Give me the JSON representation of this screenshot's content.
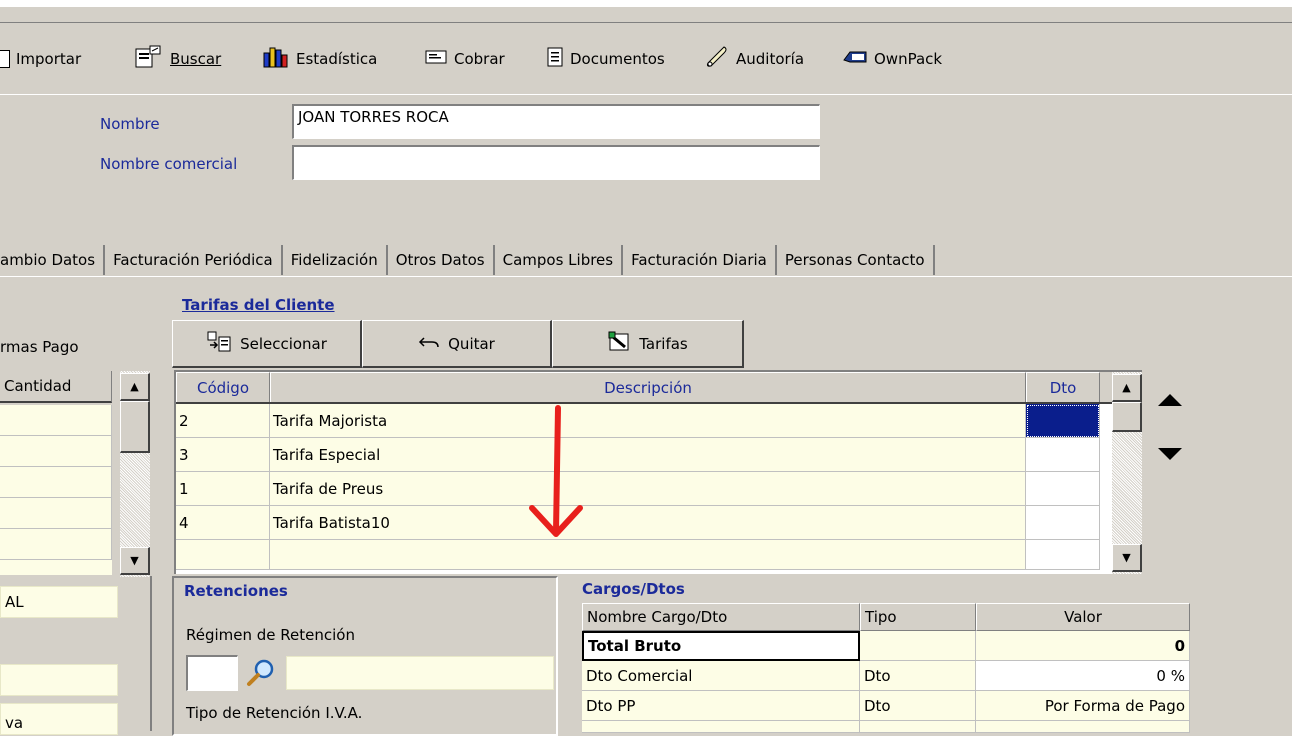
{
  "toolbar": {
    "importar": "Importar",
    "buscar": "Buscar",
    "estadistica": "Estadística",
    "cobrar": "Cobrar",
    "documentos": "Documentos",
    "auditoria": "Auditoría",
    "ownpack": "OwnPack"
  },
  "form": {
    "nombre_label": "Nombre",
    "nombre_value": "JOAN TORRES ROCA",
    "comercial_label": "Nombre comercial",
    "comercial_value": ""
  },
  "tabs": [
    {
      "label": "ambio Datos"
    },
    {
      "label": "Facturación Periódica"
    },
    {
      "label": "Fidelización"
    },
    {
      "label": "Otros Datos"
    },
    {
      "label": "Campos Libres"
    },
    {
      "label": "Facturación Diaria"
    },
    {
      "label": "Personas Contacto"
    }
  ],
  "left_panel": {
    "title": "rmas Pago",
    "column": "Cantidad",
    "field1": "AL",
    "field2": "",
    "field3": "va"
  },
  "tarifas": {
    "title": "Tarifas del Cliente",
    "buttons": {
      "seleccionar": "Seleccionar",
      "quitar": "Quitar",
      "tarifas": "Tarifas"
    },
    "columns": {
      "codigo": "Código",
      "descripcion": "Descripción",
      "dto": "Dto"
    },
    "rows": [
      {
        "codigo": "2",
        "descripcion": "Tarifa Majorista",
        "dto": ""
      },
      {
        "codigo": "3",
        "descripcion": "Tarifa Especial",
        "dto": ""
      },
      {
        "codigo": "1",
        "descripcion": "Tarifa de Preus",
        "dto": ""
      },
      {
        "codigo": "4",
        "descripcion": "Tarifa Batista10",
        "dto": ""
      }
    ]
  },
  "retenciones": {
    "title": "Retenciones",
    "regimen_label": "Régimen de Retención",
    "tipo_label": "Tipo de Retención I.V.A."
  },
  "cargos": {
    "title": "Cargos/Dtos",
    "columns": {
      "nombre": "Nombre Cargo/Dto",
      "tipo": "Tipo",
      "valor": "Valor"
    },
    "rows": [
      {
        "nombre": "Total Bruto",
        "tipo": "",
        "valor": "0"
      },
      {
        "nombre": "Dto Comercial",
        "tipo": "Dto",
        "valor": "0 %"
      },
      {
        "nombre": "Dto PP",
        "tipo": "Dto",
        "valor": "Por Forma de Pago"
      }
    ]
  },
  "colors": {
    "label_blue": "#1b2a9a",
    "selected_cell": "#0a1e8c",
    "annotation_arrow": "#e8201c",
    "row_bg": "#fdfde6"
  }
}
